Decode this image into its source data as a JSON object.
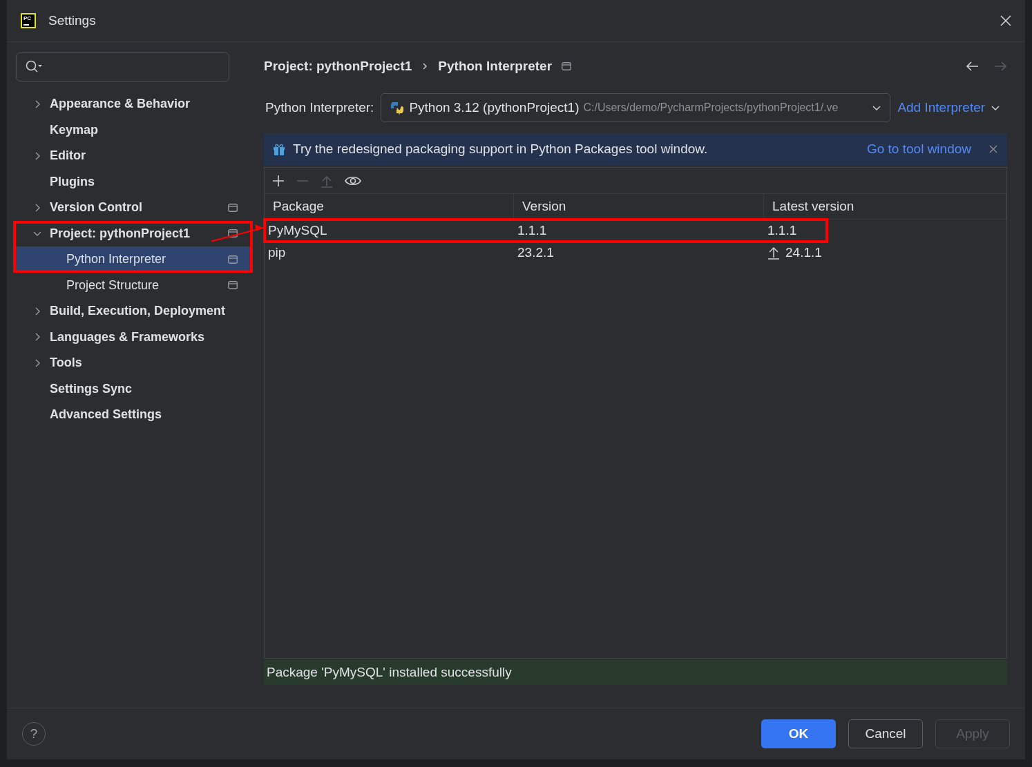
{
  "window": {
    "title": "Settings",
    "logo_text": "PC"
  },
  "sidebar": {
    "items": [
      {
        "label": "Appearance & Behavior",
        "kind": "group",
        "expanded": false,
        "project_level": false,
        "selected": false,
        "annotated": false
      },
      {
        "label": "Keymap",
        "kind": "page",
        "project_level": false,
        "selected": false,
        "annotated": false
      },
      {
        "label": "Editor",
        "kind": "group",
        "expanded": false,
        "project_level": false,
        "selected": false,
        "annotated": false
      },
      {
        "label": "Plugins",
        "kind": "page",
        "project_level": false,
        "selected": false,
        "annotated": false
      },
      {
        "label": "Version Control",
        "kind": "group",
        "expanded": false,
        "project_level": true,
        "selected": false,
        "annotated": false
      },
      {
        "label": "Project: pythonProject1",
        "kind": "group",
        "expanded": true,
        "project_level": true,
        "selected": false,
        "annotated": true,
        "children": [
          {
            "label": "Python Interpreter",
            "kind": "page",
            "project_level": true,
            "selected": true,
            "annotated": true
          },
          {
            "label": "Project Structure",
            "kind": "page",
            "project_level": true,
            "selected": false,
            "annotated": false
          }
        ]
      },
      {
        "label": "Build, Execution, Deployment",
        "kind": "group",
        "expanded": false,
        "project_level": false,
        "selected": false,
        "annotated": false
      },
      {
        "label": "Languages & Frameworks",
        "kind": "group",
        "expanded": false,
        "project_level": false,
        "selected": false,
        "annotated": false
      },
      {
        "label": "Tools",
        "kind": "group",
        "expanded": false,
        "project_level": false,
        "selected": false,
        "annotated": false
      },
      {
        "label": "Settings Sync",
        "kind": "page",
        "project_level": false,
        "selected": false,
        "annotated": false
      },
      {
        "label": "Advanced Settings",
        "kind": "page",
        "project_level": false,
        "selected": false,
        "annotated": false
      }
    ]
  },
  "breadcrumb": {
    "items": [
      "Project: pythonProject1",
      "Python Interpreter"
    ],
    "project_level": true,
    "back_disabled": false,
    "forward_disabled": true
  },
  "interpreter": {
    "label": "Python Interpreter:",
    "name": "Python 3.12 (pythonProject1)",
    "path": "C:/Users/demo/PycharmProjects/pythonProject1/.ve",
    "add_button": "Add Interpreter"
  },
  "banner": {
    "text": "Try the redesigned packaging support in Python Packages tool window.",
    "link": "Go to tool window"
  },
  "toolbar": [
    {
      "kind": "add",
      "disabled": false
    },
    {
      "kind": "remove",
      "disabled": true
    },
    {
      "kind": "upgrade",
      "disabled": true
    },
    {
      "kind": "show",
      "disabled": false
    }
  ],
  "table": {
    "columns": [
      "Package",
      "Version",
      "Latest version"
    ],
    "rows": [
      {
        "package": "PyMySQL",
        "version": "1.1.1",
        "latest": "1.1.1",
        "upgrade_available": false,
        "annotated": true
      },
      {
        "package": "pip",
        "version": "23.2.1",
        "latest": "24.1.1",
        "upgrade_available": true,
        "annotated": false
      }
    ]
  },
  "status": "Package 'PyMySQL' installed successfully",
  "footer": {
    "help": "?",
    "buttons": [
      {
        "label": "OK",
        "kind": "primary",
        "disabled": false
      },
      {
        "label": "Cancel",
        "kind": "secondary",
        "disabled": false
      },
      {
        "label": "Apply",
        "kind": "secondary",
        "disabled": true
      }
    ]
  }
}
